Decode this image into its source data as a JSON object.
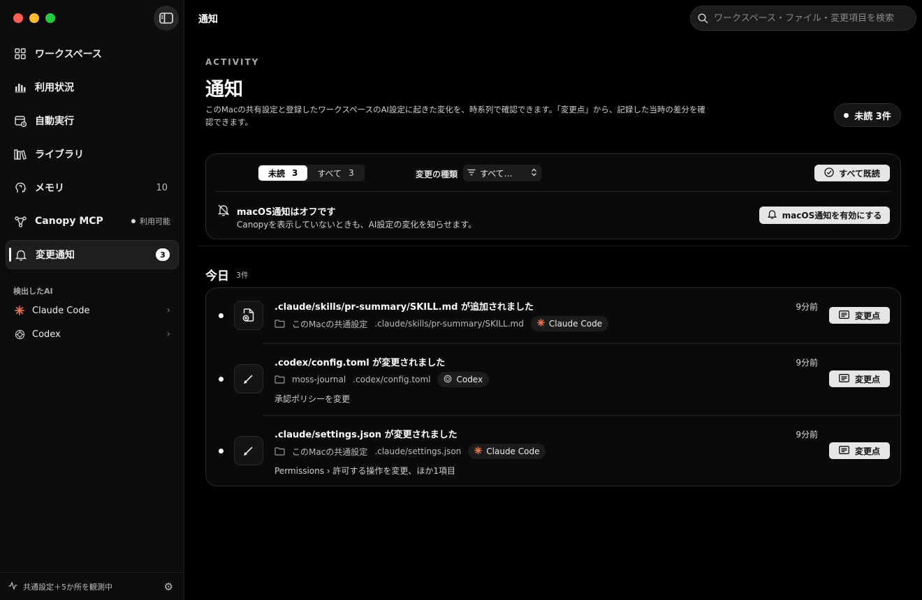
{
  "app": {
    "title": "通知"
  },
  "search": {
    "placeholder": "ワークスペース・ファイル・変更項目を検索"
  },
  "sidebar": {
    "items": [
      {
        "label": "ワークスペース",
        "icon": "grid-icon"
      },
      {
        "label": "利用状況",
        "icon": "bar-chart-icon"
      },
      {
        "label": "自動実行",
        "icon": "calendar-clock-icon"
      },
      {
        "label": "ライブラリ",
        "icon": "library-icon"
      },
      {
        "label": "メモリ",
        "icon": "brain-icon",
        "count": "10"
      },
      {
        "label": "Canopy MCP",
        "icon": "network-icon",
        "status": "利用可能"
      },
      {
        "label": "変更通知",
        "icon": "bell-icon",
        "badge": "3",
        "active": true
      }
    ],
    "section_label": "検出したAI",
    "ai_items": [
      {
        "label": "Claude Code",
        "icon": "claude-icon"
      },
      {
        "label": "Codex",
        "icon": "codex-icon"
      }
    ],
    "footer": "共通設定＋5か所を観測中"
  },
  "header": {
    "eyebrow": "ACTIVITY",
    "title": "通知",
    "description": "このMacの共有設定と登録したワークスペースのAI設定に起きた変化を、時系列で確認できます。「変更点」から、記録した当時の差分を確認できます。",
    "unread_pill": "未読 3件"
  },
  "filters": {
    "tabs": [
      {
        "label": "未読",
        "count": "3",
        "selected": true
      },
      {
        "label": "すべて",
        "count": "3",
        "selected": false
      }
    ],
    "kind_label": "変更の種類",
    "kind_value": "すべて…",
    "mark_all_label": "すべて既読"
  },
  "macos_notice": {
    "title": "macOS通知はオフです",
    "subtitle": "Canopyを表示していないときも、AI設定の変化を知らせます。",
    "button": "macOS通知を有効にする"
  },
  "today": {
    "title": "今日",
    "count": "3件",
    "items": [
      {
        "title": ".claude/skills/pr-summary/SKILL.md が追加されました",
        "workspace": "このMacの共通設定",
        "path": ".claude/skills/pr-summary/SKILL.md",
        "ai": "Claude Code",
        "detail": "",
        "time": "9分前",
        "button": "変更点",
        "kind_icon": "file-add-icon"
      },
      {
        "title": ".codex/config.toml が変更されました",
        "workspace": "moss-journal",
        "path": ".codex/config.toml",
        "ai": "Codex",
        "detail": "承認ポリシーを変更",
        "time": "9分前",
        "button": "変更点",
        "kind_icon": "pencil-icon"
      },
      {
        "title": ".claude/settings.json が変更されました",
        "workspace": "このMacの共通設定",
        "path": ".claude/settings.json",
        "ai": "Claude Code",
        "detail": "Permissions  ›  許可する操作を変更、ほか1項目",
        "time": "9分前",
        "button": "変更点",
        "kind_icon": "pencil-icon"
      }
    ]
  },
  "colors": {
    "claude_accent": "#e0714f",
    "background": "#000000",
    "button_light": "#e6e6e6"
  }
}
